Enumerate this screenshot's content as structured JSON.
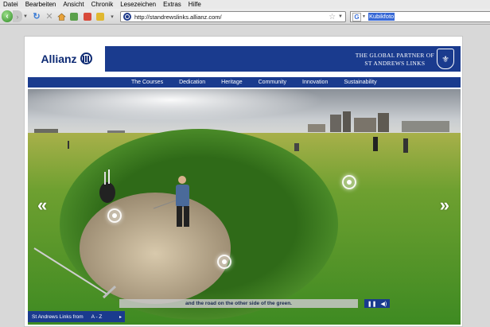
{
  "menu": {
    "items": [
      "Datei",
      "Bearbeiten",
      "Ansicht",
      "Chronik",
      "Lesezeichen",
      "Extras",
      "Hilfe"
    ]
  },
  "toolbar": {
    "back_glyph": "‹",
    "forward_glyph": "›",
    "url": "http://standrewslinks.allianz.com/",
    "search_value": "Kubikfoto",
    "search_engine_glyph": "G"
  },
  "colors": {
    "brand_blue": "#1a3b8e",
    "page_bg": "#ffffff"
  },
  "header": {
    "logo_text": "Allianz",
    "partner_line1": "THE GLOBAL PARTNER OF",
    "partner_line2": "ST ANDREWS LINKS"
  },
  "nav": {
    "items": [
      "The Courses",
      "Dedication",
      "Heritage",
      "Community",
      "Innovation",
      "Sustainability"
    ]
  },
  "panorama": {
    "prev_arrow": "«",
    "next_arrow": "»",
    "caption": "and the road on the other side of the green.",
    "pause_glyph": "❚❚",
    "volume_glyph": "◀)"
  },
  "footer": {
    "links_label": "St Andrews Links from",
    "az_label": "A - Z",
    "arrow_glyph": "▸"
  }
}
